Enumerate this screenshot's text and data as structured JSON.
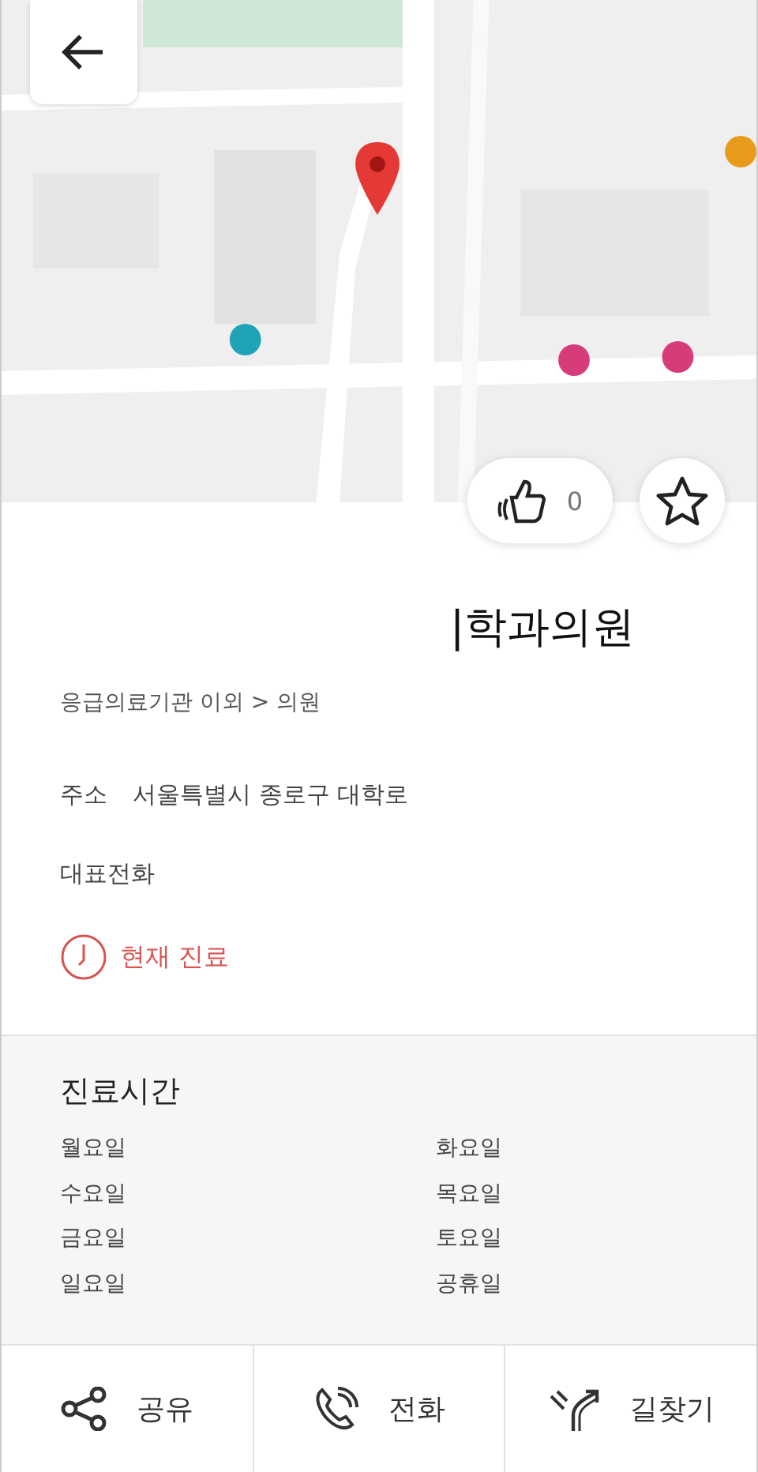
{
  "like_count": "0",
  "place": {
    "name": "|학과의원",
    "category": "응급의료기관 이외 > 의원",
    "address_label": "주소",
    "address": "서울특별시 종로구 대학로",
    "phone_label": "대표전화",
    "status": "현재 진료"
  },
  "hours": {
    "title": "진료시간",
    "days": [
      {
        "label": "월요일"
      },
      {
        "label": "화요일"
      },
      {
        "label": "수요일"
      },
      {
        "label": "목요일"
      },
      {
        "label": "금요일"
      },
      {
        "label": "토요일"
      },
      {
        "label": "일요일"
      },
      {
        "label": "공휴일"
      }
    ]
  },
  "actions": [
    {
      "kind": "share",
      "label": "공유"
    },
    {
      "kind": "call",
      "label": "전화"
    },
    {
      "kind": "directions",
      "label": "길찾기"
    }
  ]
}
